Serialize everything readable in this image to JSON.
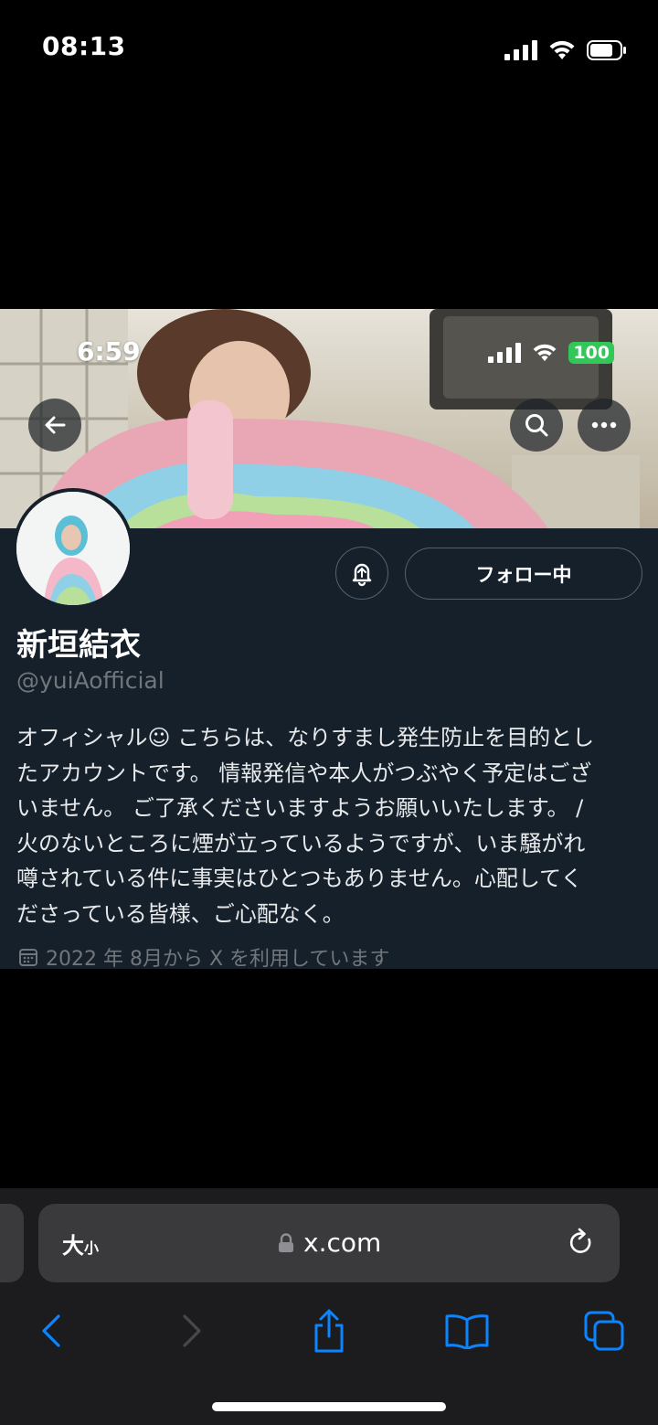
{
  "device_status": {
    "time": "08:13",
    "icons": [
      "cellular-signal-icon",
      "wifi-icon",
      "battery-icon"
    ]
  },
  "profile_screenshot": {
    "status": {
      "time": "6:59",
      "battery": "100"
    },
    "header_buttons": [
      "back-icon",
      "search-icon",
      "more-icon"
    ],
    "notify_icon": "bell-icon",
    "follow_label": "フォロー中",
    "display_name": "新垣結衣",
    "handle": "@yuiAofficial",
    "bio_lines": [
      "オフィシャル☺ こちらは、なりすまし発生防止を目的とし",
      "たアカウントです。 情報発信や本人がつぶやく予定はござ",
      "いません。 ご了承くださいますようお願いいたします。 /",
      "火のないところに煙が立っているようですが、いま騒がれ",
      "噂されている件に事実はひとつもありません。心配してく",
      "ださっている皆様、ご心配なく。"
    ],
    "joined": "2022 年 8月から X を利用しています"
  },
  "browser": {
    "text_size_label": "大",
    "text_size_label_small": "小",
    "url": "x.com",
    "toolbar_icons": [
      "back-icon",
      "forward-icon",
      "share-icon",
      "bookmarks-icon",
      "tabs-icon"
    ]
  },
  "colors": {
    "x_dark_bg": "#15202b",
    "accent_blue": "#0a84ff",
    "battery_green": "#33c759"
  }
}
